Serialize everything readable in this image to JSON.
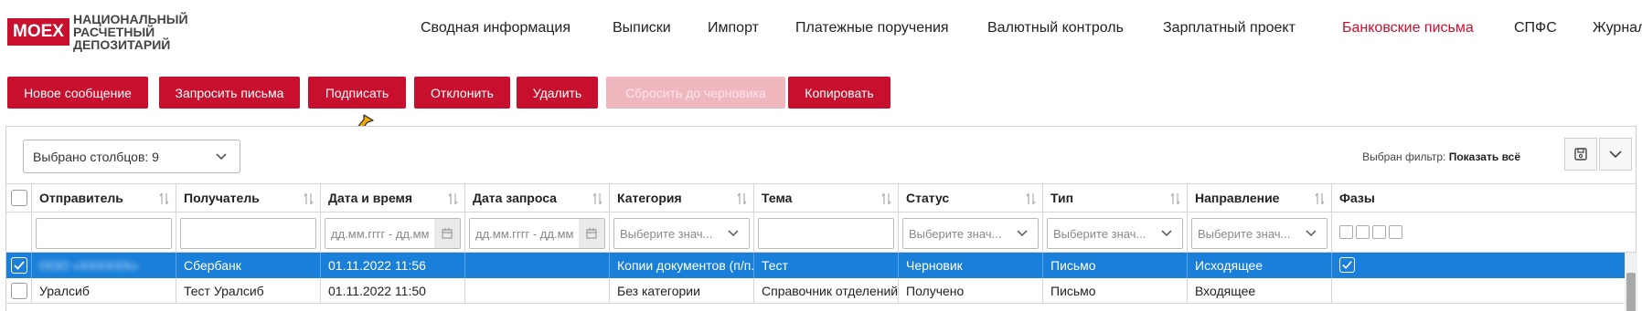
{
  "header": {
    "logo_badge": "MOEX",
    "logo_lines": [
      "НАЦИОНАЛЬНЫЙ",
      "РАСЧЕТНЫЙ",
      "ДЕПОЗИТАРИЙ"
    ],
    "nav": [
      {
        "label": "Сводная информация",
        "active": false
      },
      {
        "label": "Выписки",
        "active": false
      },
      {
        "label": "Импорт",
        "active": false
      },
      {
        "label": "Платежные поручения",
        "active": false
      },
      {
        "label": "Валютный контроль",
        "active": false
      },
      {
        "label": "Зарплатный проект",
        "active": false
      },
      {
        "label": "Банковские письма",
        "active": true
      },
      {
        "label": "СПФС",
        "active": false
      },
      {
        "label": "Журнал",
        "active": false
      }
    ]
  },
  "toolbar": {
    "buttons": [
      {
        "label": "Новое сообщение",
        "disabled": false
      },
      {
        "label": "Запросить письма",
        "disabled": false
      },
      {
        "label": "Подписать",
        "disabled": false
      },
      {
        "label": "Отклонить",
        "disabled": false
      },
      {
        "label": "Удалить",
        "disabled": false
      },
      {
        "label": "Сбросить до черновика",
        "disabled": true
      },
      {
        "label": "Копировать",
        "disabled": false
      }
    ]
  },
  "grid": {
    "columns_selected": "Выбрано столбцов: 9",
    "filter_label": "Выбран фильтр:",
    "filter_value": "Показать всё",
    "columns": [
      "Отправитель",
      "Получатель",
      "Дата и время",
      "Дата запроса",
      "Категория",
      "Тема",
      "Статус",
      "Тип",
      "Направление",
      "Фазы"
    ],
    "filters": {
      "date_placeholder": "дд.мм.гггг - дд.мм",
      "select_placeholder": "Выберите знач..."
    },
    "rows": [
      {
        "selected": true,
        "sender": "ООО «ХХХХХХ»",
        "recipient": "Сбербанк",
        "datetime": "01.11.2022 11:56",
        "request_date": "",
        "category": "Копии документов (п/п...",
        "subject": "Тест",
        "status": "Черновик",
        "type": "Письмо",
        "direction": "Исходящее",
        "phase_checked": true
      },
      {
        "selected": false,
        "sender": "Уралсиб",
        "recipient": "Тест Уралсиб",
        "datetime": "01.11.2022 11:50",
        "request_date": "",
        "category": "Без категории",
        "subject": "Справочник отделений...",
        "status": "Получено",
        "type": "Письмо",
        "direction": "Входящее",
        "phase_checked": false
      }
    ]
  },
  "colors": {
    "brand": "#c8102e",
    "selected_row": "#1a7fd9",
    "cursor": "#f5a800"
  }
}
